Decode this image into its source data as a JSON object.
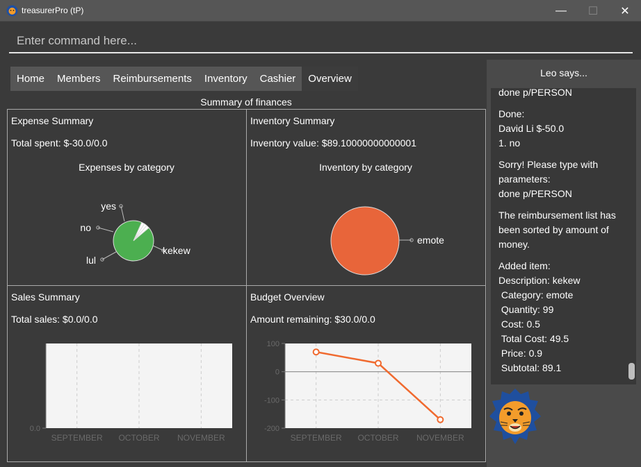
{
  "window": {
    "title": "treasurerPro (tP)",
    "minimize": "—",
    "maximize": "☐",
    "close": "✕"
  },
  "command": {
    "placeholder": "Enter command here..."
  },
  "tabs": [
    "Home",
    "Members",
    "Reimbursements",
    "Inventory",
    "Cashier",
    "Overview"
  ],
  "active_tab": "Overview",
  "overview": {
    "title": "Summary of finances",
    "expense": {
      "title": "Expense Summary",
      "stat": "Total spent: $-30.0/0.0"
    },
    "inventory": {
      "title": "Inventory Summary",
      "stat": "Inventory value: $89.10000000000001"
    },
    "sales": {
      "title": "Sales Summary",
      "stat": "Total sales: $0.0/0.0"
    },
    "budget": {
      "title": "Budget Overview",
      "stat": "Amount remaining: $30.0/0.0"
    }
  },
  "chart_data": [
    {
      "type": "pie",
      "title": "Expenses by category",
      "labels": [
        "yes",
        "no",
        "lul",
        "kekew"
      ],
      "values": [
        0.01,
        0.01,
        0.01,
        0.39
      ],
      "colors": [
        "#ffffff",
        "#ffffff",
        "#ffffff",
        "#4caf50"
      ]
    },
    {
      "type": "pie",
      "title": "Inventory by category",
      "labels": [
        "emote"
      ],
      "values": [
        1
      ],
      "colors": [
        "#e8653a"
      ]
    },
    {
      "type": "line",
      "categories": [
        "SEPTEMBER",
        "OCTOBER",
        "NOVEMBER"
      ],
      "ylim": [
        0,
        0.1
      ],
      "yticks": [
        "0.0"
      ],
      "series": [],
      "grid": true
    },
    {
      "type": "line",
      "categories": [
        "SEPTEMBER",
        "OCTOBER",
        "NOVEMBER"
      ],
      "ylim": [
        -200,
        100
      ],
      "yticks": [
        "100",
        "0",
        "-100",
        "-200"
      ],
      "series": [
        {
          "values": [
            70,
            30,
            -170
          ],
          "color": "#f06a2f"
        }
      ],
      "grid": true
    }
  ],
  "assistant": {
    "title": "Leo says...",
    "messages": [
      "done p/PERSON",
      "Done:\nDavid Li $-50.0\n1. no",
      "Sorry! Please type with parameters:\ndone p/PERSON",
      "The reimbursement list has been sorted by amount of money.",
      "Added item:\nDescription: kekew\n Category: emote\n Quantity: 99\n Cost: 0.5\n Total Cost: 49.5\n Price: 0.9\n Subtotal: 89.1"
    ]
  }
}
